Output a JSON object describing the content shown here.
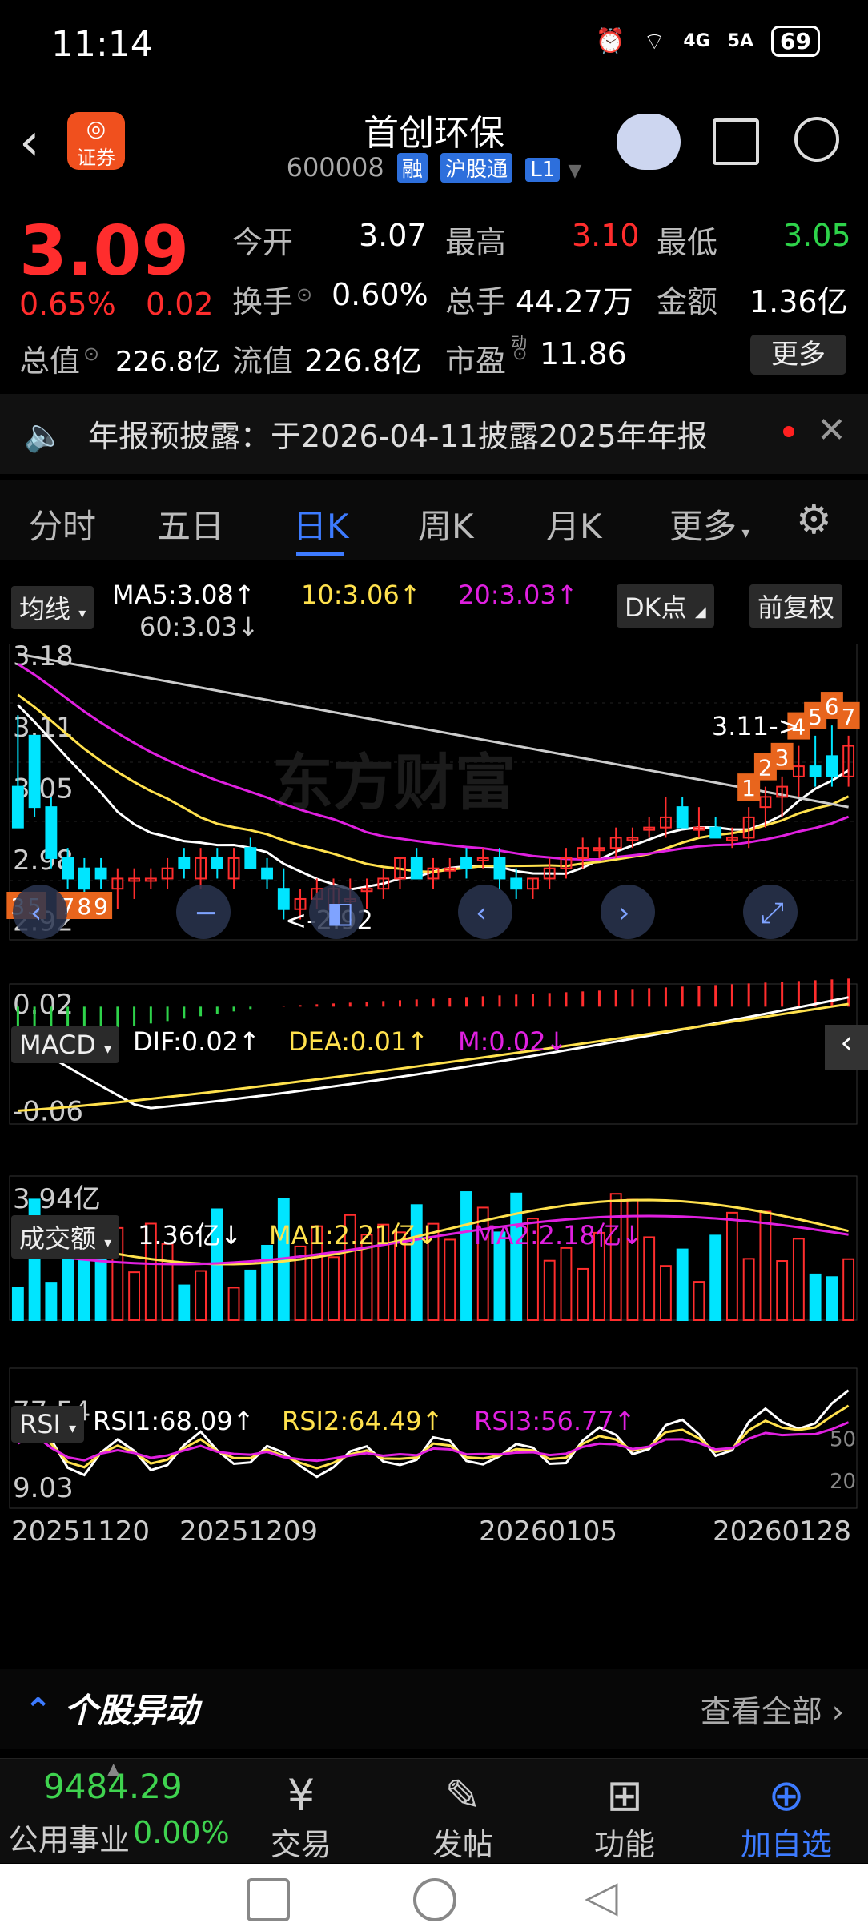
{
  "status": {
    "time": "11:14",
    "net1": "4G",
    "net2": "5A",
    "battery": "69"
  },
  "header": {
    "broker": "证券",
    "title": "首创环保",
    "code": "600008",
    "tags": [
      "融",
      "沪股通",
      "L1"
    ]
  },
  "quote": {
    "price": "3.09",
    "pct": "0.65%",
    "change": "0.02",
    "open_label": "今开",
    "open": "3.07",
    "high_label": "最高",
    "high": "3.10",
    "low_label": "最低",
    "low": "3.05",
    "turnover_label": "换手",
    "turnover": "0.60%",
    "volume_label": "总手",
    "volume": "44.27万",
    "amount_label": "金额",
    "amount": "1.36亿",
    "mktcap_label": "总值",
    "mktcap": "226.8亿",
    "float_label": "流值",
    "float": "226.8亿",
    "pe_label": "市盈",
    "pe_sup": "动",
    "pe": "11.86",
    "more": "更多"
  },
  "notice": {
    "text": "年报预披露：于2026-04-11披露2025年年报"
  },
  "tabs": [
    "分时",
    "五日",
    "日K",
    "周K",
    "月K",
    "更多"
  ],
  "active_tab": 2,
  "colors": {
    "up": "#ff2d2d",
    "down": "#00e5ff",
    "ma5": "#ffffff",
    "ma10": "#ffe14d",
    "ma20": "#e020e0",
    "ma60": "#cccccc",
    "accent": "#3d7bff"
  },
  "chart_data": {
    "type": "candlestick",
    "title": "",
    "ma": {
      "label": "均线",
      "ma5": "MA5:3.08↑",
      "ma10": "10:3.06↑",
      "ma20": "20:3.03↑",
      "ma60": "60:3.03↓"
    },
    "dk_label": "DK点",
    "adjust_label": "前复权",
    "ylabels": [
      "3.18",
      "3.11",
      "3.05",
      "2.98",
      "2.92"
    ],
    "max_note": "3.11->",
    "min_note": "<-2.92",
    "candles": [
      [
        3.05,
        3.12,
        3.02,
        3.01
      ],
      [
        3.1,
        3.1,
        3.02,
        3.03
      ],
      [
        3.03,
        3.04,
        2.97,
        2.98
      ],
      [
        2.98,
        2.99,
        2.95,
        2.96
      ],
      [
        2.97,
        2.98,
        2.94,
        2.95
      ],
      [
        2.97,
        2.98,
        2.95,
        2.96
      ],
      [
        2.95,
        2.97,
        2.93,
        2.96
      ],
      [
        2.96,
        2.97,
        2.94,
        2.96
      ],
      [
        2.96,
        2.97,
        2.95,
        2.96
      ],
      [
        2.96,
        2.98,
        2.95,
        2.97
      ],
      [
        2.98,
        2.99,
        2.96,
        2.97
      ],
      [
        2.96,
        2.99,
        2.95,
        2.98
      ],
      [
        2.98,
        2.99,
        2.96,
        2.97
      ],
      [
        2.96,
        2.99,
        2.95,
        2.98
      ],
      [
        2.99,
        3.0,
        2.97,
        2.97
      ],
      [
        2.97,
        2.98,
        2.95,
        2.96
      ],
      [
        2.95,
        2.97,
        2.92,
        2.93
      ],
      [
        2.93,
        2.95,
        2.92,
        2.94
      ],
      [
        2.94,
        2.96,
        2.93,
        2.95
      ],
      [
        2.93,
        2.96,
        2.92,
        2.95
      ],
      [
        2.94,
        2.96,
        2.93,
        2.94
      ],
      [
        2.95,
        2.96,
        2.93,
        2.95
      ],
      [
        2.95,
        2.97,
        2.94,
        2.96
      ],
      [
        2.96,
        2.98,
        2.95,
        2.98
      ],
      [
        2.98,
        2.99,
        2.96,
        2.96
      ],
      [
        2.96,
        2.98,
        2.95,
        2.97
      ],
      [
        2.97,
        2.98,
        2.96,
        2.97
      ],
      [
        2.98,
        2.99,
        2.96,
        2.97
      ],
      [
        2.98,
        2.99,
        2.97,
        2.98
      ],
      [
        2.98,
        2.99,
        2.95,
        2.96
      ],
      [
        2.96,
        2.97,
        2.94,
        2.95
      ],
      [
        2.95,
        2.96,
        2.94,
        2.96
      ],
      [
        2.96,
        2.98,
        2.95,
        2.97
      ],
      [
        2.97,
        2.99,
        2.96,
        2.98
      ],
      [
        2.98,
        3.0,
        2.97,
        2.99
      ],
      [
        2.99,
        3.0,
        2.98,
        2.99
      ],
      [
        2.99,
        3.01,
        2.98,
        3.0
      ],
      [
        3.0,
        3.01,
        2.99,
        3.0
      ],
      [
        3.01,
        3.02,
        3.0,
        3.01
      ],
      [
        3.01,
        3.04,
        3.0,
        3.02
      ],
      [
        3.03,
        3.04,
        3.01,
        3.01
      ],
      [
        3.01,
        3.03,
        3.0,
        3.01
      ],
      [
        3.01,
        3.02,
        3.0,
        3.0
      ],
      [
        3.0,
        3.01,
        2.99,
        3.0
      ],
      [
        3.0,
        3.03,
        2.99,
        3.02
      ],
      [
        3.03,
        3.05,
        3.01,
        3.04
      ],
      [
        3.04,
        3.06,
        3.02,
        3.05
      ],
      [
        3.06,
        3.09,
        3.04,
        3.07
      ],
      [
        3.07,
        3.1,
        3.05,
        3.06
      ],
      [
        3.08,
        3.11,
        3.05,
        3.06
      ],
      [
        3.06,
        3.1,
        3.05,
        3.09
      ]
    ],
    "marks": [
      {
        "idx": 0,
        "label": "3"
      },
      {
        "idx": 1,
        "label": "5"
      },
      {
        "idx": 3,
        "label": "7"
      },
      {
        "idx": 4,
        "label": "8"
      },
      {
        "idx": 5,
        "label": "9"
      },
      {
        "idx": 44,
        "label": "1"
      },
      {
        "idx": 45,
        "label": "2"
      },
      {
        "idx": 46,
        "label": "3"
      },
      {
        "idx": 47,
        "label": "4"
      },
      {
        "idx": 48,
        "label": "5"
      },
      {
        "idx": 49,
        "label": "6"
      },
      {
        "idx": 50,
        "label": "7"
      }
    ],
    "macd": {
      "label": "MACD",
      "dif": "DIF:0.02↑",
      "dea": "DEA:0.01↑",
      "m": "M:0.02↓",
      "ylabels": [
        "0.02",
        "-0.06"
      ]
    },
    "volume": {
      "label": "成交额",
      "value": "1.36亿↓",
      "ma1": "MA1:2.21亿↓",
      "ma2": "MA2:2.18亿↓",
      "ylabel": "3.94亿"
    },
    "rsi": {
      "label": "RSI",
      "rsi1": "RSI1:68.09↑",
      "rsi2": "RSI2:64.49↑",
      "rsi3": "RSI3:56.77↑",
      "ylabels": [
        "77.54",
        "9.03"
      ],
      "levels": [
        "50",
        "20"
      ]
    },
    "dates": [
      "20251120",
      "20251209",
      "20260105",
      "20260128"
    ],
    "watermark": "东方财富"
  },
  "section": {
    "title": "个股异动",
    "link": "查看全部"
  },
  "bottom": {
    "index_value": "9484.29",
    "index_name": "公用事业",
    "index_pct": "0.00%",
    "items": [
      "交易",
      "发帖",
      "功能",
      "加自选"
    ]
  }
}
